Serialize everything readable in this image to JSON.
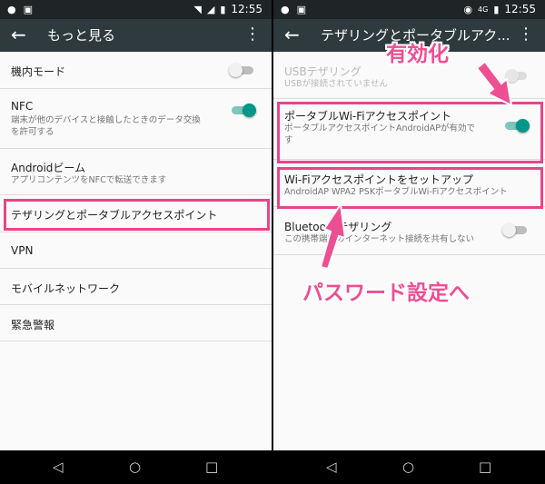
{
  "colors": {
    "accent": "#009688",
    "annotation": "#ec4f92",
    "toolbar": "#2f3a3e",
    "statusbar": "#1f2527"
  },
  "left": {
    "status": {
      "left_icons": [
        "chat-bubble-icon",
        "image-icon"
      ],
      "right_icons": [
        "wifi-icon",
        "signal-icon",
        "battery-icon"
      ],
      "time": "12:55"
    },
    "toolbar": {
      "back": "←",
      "title": "もっと見る",
      "menu": "⋮"
    },
    "items": [
      {
        "title": "機内モード",
        "switch": "off"
      },
      {
        "title": "NFC",
        "summary": "端末が他のデバイスと接触したときのデータ交換\nを許可する",
        "switch": "on"
      },
      {
        "title": "Androidビーム",
        "summary": "アプリコンテンツをNFCで転送できます"
      },
      {
        "title": "テザリングとポータブルアクセスポイント"
      },
      {
        "title": "VPN"
      },
      {
        "title": "モバイルネットワーク"
      },
      {
        "title": "緊急警報"
      }
    ]
  },
  "right": {
    "status": {
      "left_icons": [
        "chat-bubble-icon",
        "image-icon"
      ],
      "right_icons": [
        "hotspot-icon",
        "4g-signal-icon",
        "battery-icon"
      ],
      "network": "4G",
      "time": "12:55"
    },
    "toolbar": {
      "back": "←",
      "title": "テザリングとポータブルアク...",
      "menu": "⋮"
    },
    "items": [
      {
        "title": "USBテザリング",
        "summary": "USBが接続されていません",
        "switch": "disabled"
      },
      {
        "title": "ポータブルWi-Fiアクセスポイント",
        "summary": "ポータブルアクセスポイントAndroidAPが有効で\nす",
        "switch": "on"
      },
      {
        "title": "Wi-Fiアクセスポイントをセットアップ",
        "summary": "AndroidAP WPA2 PSKポータブルWi-Fiアクセスポイント"
      },
      {
        "title": "Bluetoothテザリング",
        "summary": "この携帯端末のインターネット接続を共有しない",
        "switch": "off"
      }
    ]
  },
  "annotations": {
    "enable": "有効化",
    "to_password": "パスワード設定へ"
  },
  "nav": {
    "back": "◁",
    "home": "○",
    "recent": "□"
  }
}
